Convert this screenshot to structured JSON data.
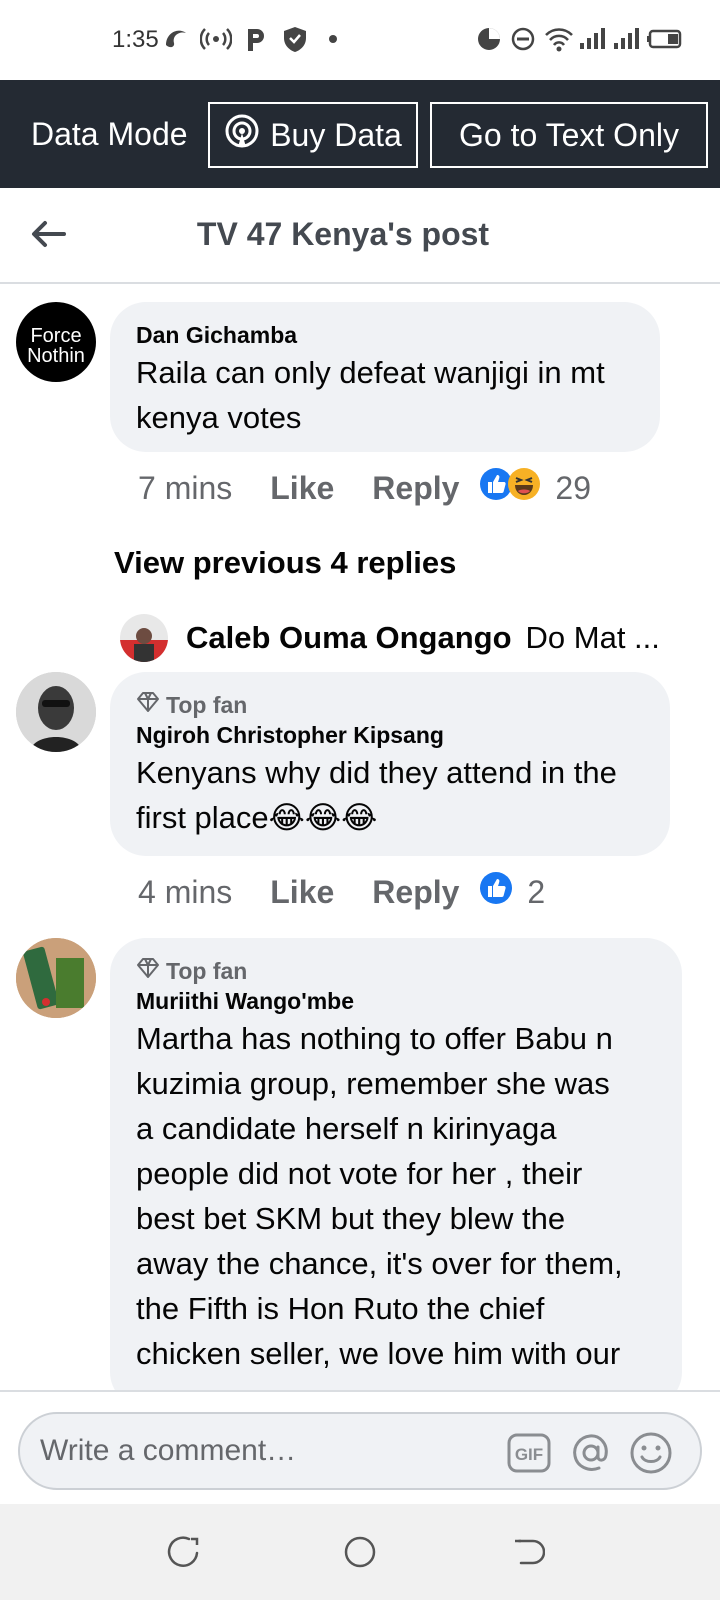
{
  "status_bar": {
    "time": "1:35"
  },
  "data_bar": {
    "mode_label": "Data Mode",
    "buy_data_label": "Buy Data",
    "text_only_label": "Go to Text Only"
  },
  "header": {
    "title": "TV 47 Kenya's post"
  },
  "comments": [
    {
      "author": "Dan Gichamba",
      "avatar_text_line1": "Force",
      "avatar_text_line2": "Nothin",
      "lines": [
        "Raila can only defeat wanjigi in mt",
        "kenya votes"
      ],
      "time": "7 mins",
      "like_label": "Like",
      "reply_label": "Reply",
      "reaction_count": "29",
      "view_previous": "View previous 4 replies",
      "latest_reply": {
        "author": "Caleb Ouma Ongango",
        "snippet": "Do Mat ..."
      }
    },
    {
      "badge": "Top fan",
      "author": "Ngiroh Christopher Kipsang",
      "lines": [
        "Kenyans why did they attend in the",
        "first place"
      ],
      "emoji": "😂😂😂",
      "time": "4 mins",
      "like_label": "Like",
      "reply_label": "Reply",
      "reaction_count": "2"
    },
    {
      "badge": "Top fan",
      "author": "Muriithi Wango'mbe",
      "lines": [
        "Martha has nothing to offer Babu n",
        "kuzimia group, remember she was",
        "a candidate herself n kirinyaga",
        "people did not vote for her , their",
        "best bet SKM but they blew the",
        "away the chance, it's over for them,",
        "the Fifth is Hon Ruto the chief",
        "chicken seller, we love him with our"
      ]
    }
  ],
  "composer": {
    "placeholder": "Write a comment…"
  },
  "colors": {
    "data_bar_bg": "#242a33",
    "like_blue": "#1877f2",
    "bubble_bg": "#f0f2f5"
  }
}
